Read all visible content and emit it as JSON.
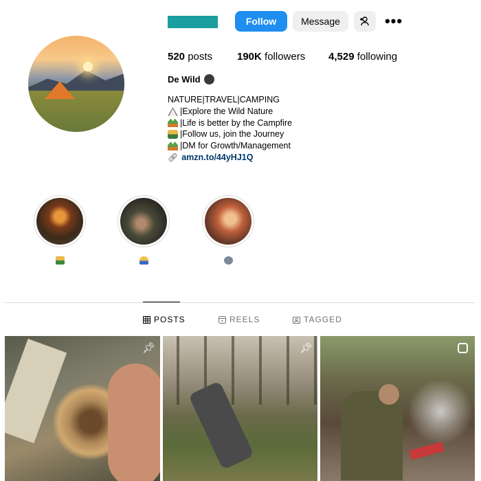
{
  "profile": {
    "follow_label": "Follow",
    "message_label": "Message",
    "posts_count": "520",
    "posts_label": "posts",
    "followers_count": "190K",
    "followers_label": "followers",
    "following_count": "4,529",
    "following_label": "following",
    "display_name": "De Wild",
    "bio": {
      "line1": "NATURE|TRAVEL|CAMPING",
      "line2": "|Explore the Wild Nature",
      "line3": "|Life is better by the Campfire",
      "line4": "|Follow us, join the Journey",
      "line5": "|DM for Growth/Management",
      "link": "amzn.to/44yHJ1Q"
    },
    "accent_color": "#1f8ef1",
    "username_bar_color": "#1a9e9e"
  },
  "highlights": [
    {
      "icon": "people-emoji"
    },
    {
      "icon": "person-emoji"
    },
    {
      "icon": "face-emoji"
    }
  ],
  "tabs": {
    "posts": "POSTS",
    "reels": "REELS",
    "tagged": "TAGGED",
    "active": "posts"
  },
  "posts": [
    {
      "icon": "pin-icon"
    },
    {
      "icon": "pin-icon"
    },
    {
      "icon": "reel-icon"
    }
  ]
}
